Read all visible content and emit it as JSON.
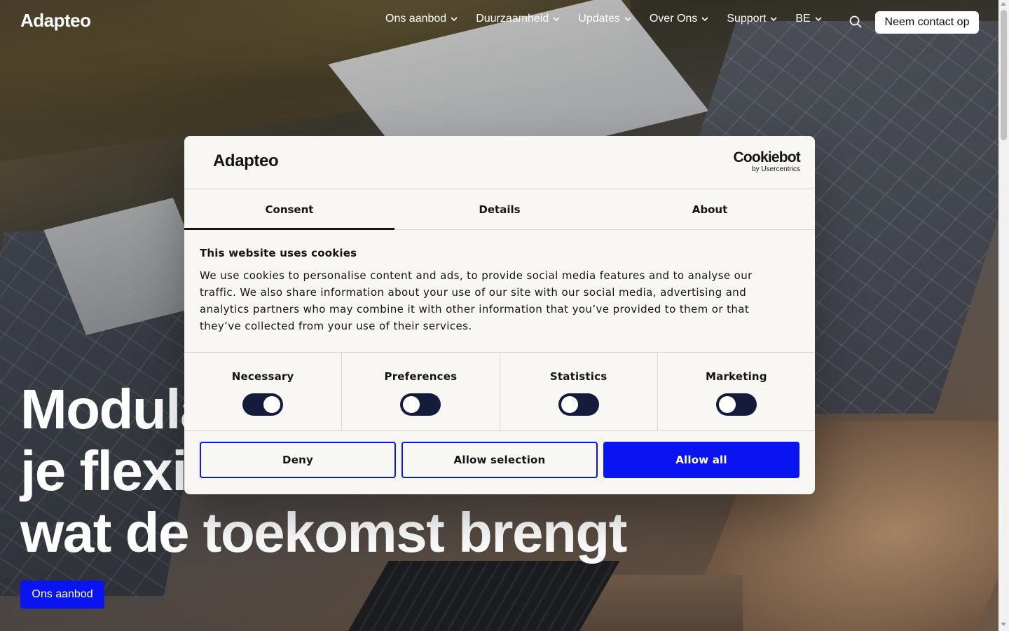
{
  "header": {
    "logo": "Adapteo",
    "nav": [
      {
        "label": "Ons aanbod"
      },
      {
        "label": "Duurzaamheid"
      },
      {
        "label": "Updates"
      },
      {
        "label": "Over Ons"
      },
      {
        "label": "Support"
      },
      {
        "label": "BE"
      }
    ],
    "contact_label": "Neem contact op"
  },
  "hero": {
    "title_line1": "Modulaire",
    "title_line2": "je flexibel",
    "title_line3": "wat de toekomst brengt",
    "cta_label": "Ons aanbod"
  },
  "cookie_dialog": {
    "logo": "Adapteo",
    "provider_name": "Cookiebot",
    "provider_by": "by Usercentrics",
    "tabs": [
      {
        "label": "Consent",
        "active": true
      },
      {
        "label": "Details",
        "active": false
      },
      {
        "label": "About",
        "active": false
      }
    ],
    "heading": "This website uses cookies",
    "body": "We use cookies to personalise content and ads, to provide social media features and to analyse our traffic. We also share information about your use of our site with our social media, advertising and analytics partners who may combine it with other information that you’ve provided to them or that they’ve collected from your use of their services.",
    "categories": [
      {
        "label": "Necessary",
        "enabled": true
      },
      {
        "label": "Preferences",
        "enabled": false
      },
      {
        "label": "Statistics",
        "enabled": false
      },
      {
        "label": "Marketing",
        "enabled": false
      }
    ],
    "buttons": {
      "deny": "Deny",
      "allow_selection": "Allow selection",
      "allow_all": "Allow all"
    }
  },
  "colors": {
    "accent": "#0a14f0",
    "toggle_track": "#141b3b",
    "dialog_bg": "#f8f7f4"
  },
  "icons": {
    "chevron": "chevron-down-icon",
    "search": "search-icon"
  }
}
